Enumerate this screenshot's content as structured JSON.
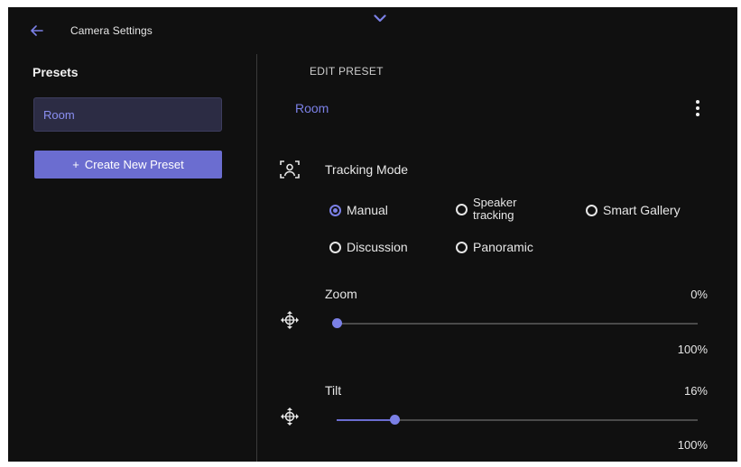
{
  "header": {
    "title": "Camera Settings",
    "back_icon": "arrow-left-icon",
    "collapse_icon": "chevron-down-icon"
  },
  "presets": {
    "title": "Presets",
    "items": [
      {
        "label": "Room"
      }
    ],
    "create_label": "Create New Preset",
    "create_icon": "plus-icon"
  },
  "edit": {
    "title": "EDIT PRESET",
    "preset_name": "Room",
    "tracking": {
      "label": "Tracking Mode",
      "options": [
        {
          "label": "Manual",
          "selected": true
        },
        {
          "label": "Speaker tracking",
          "line1": "Speaker",
          "line2": "tracking",
          "selected": false
        },
        {
          "label": "Smart Gallery",
          "selected": false
        },
        {
          "label": "Discussion",
          "selected": false
        },
        {
          "label": "Panoramic",
          "selected": false
        }
      ]
    },
    "zoom": {
      "label": "Zoom",
      "value_text": "0%",
      "max_text": "100%",
      "value": 0
    },
    "tilt": {
      "label": "Tilt",
      "value_text": "16%",
      "max_text": "100%",
      "value": 16
    }
  },
  "colors": {
    "accent": "#7b80e6",
    "background": "#101010",
    "button": "#6b6dd0"
  }
}
